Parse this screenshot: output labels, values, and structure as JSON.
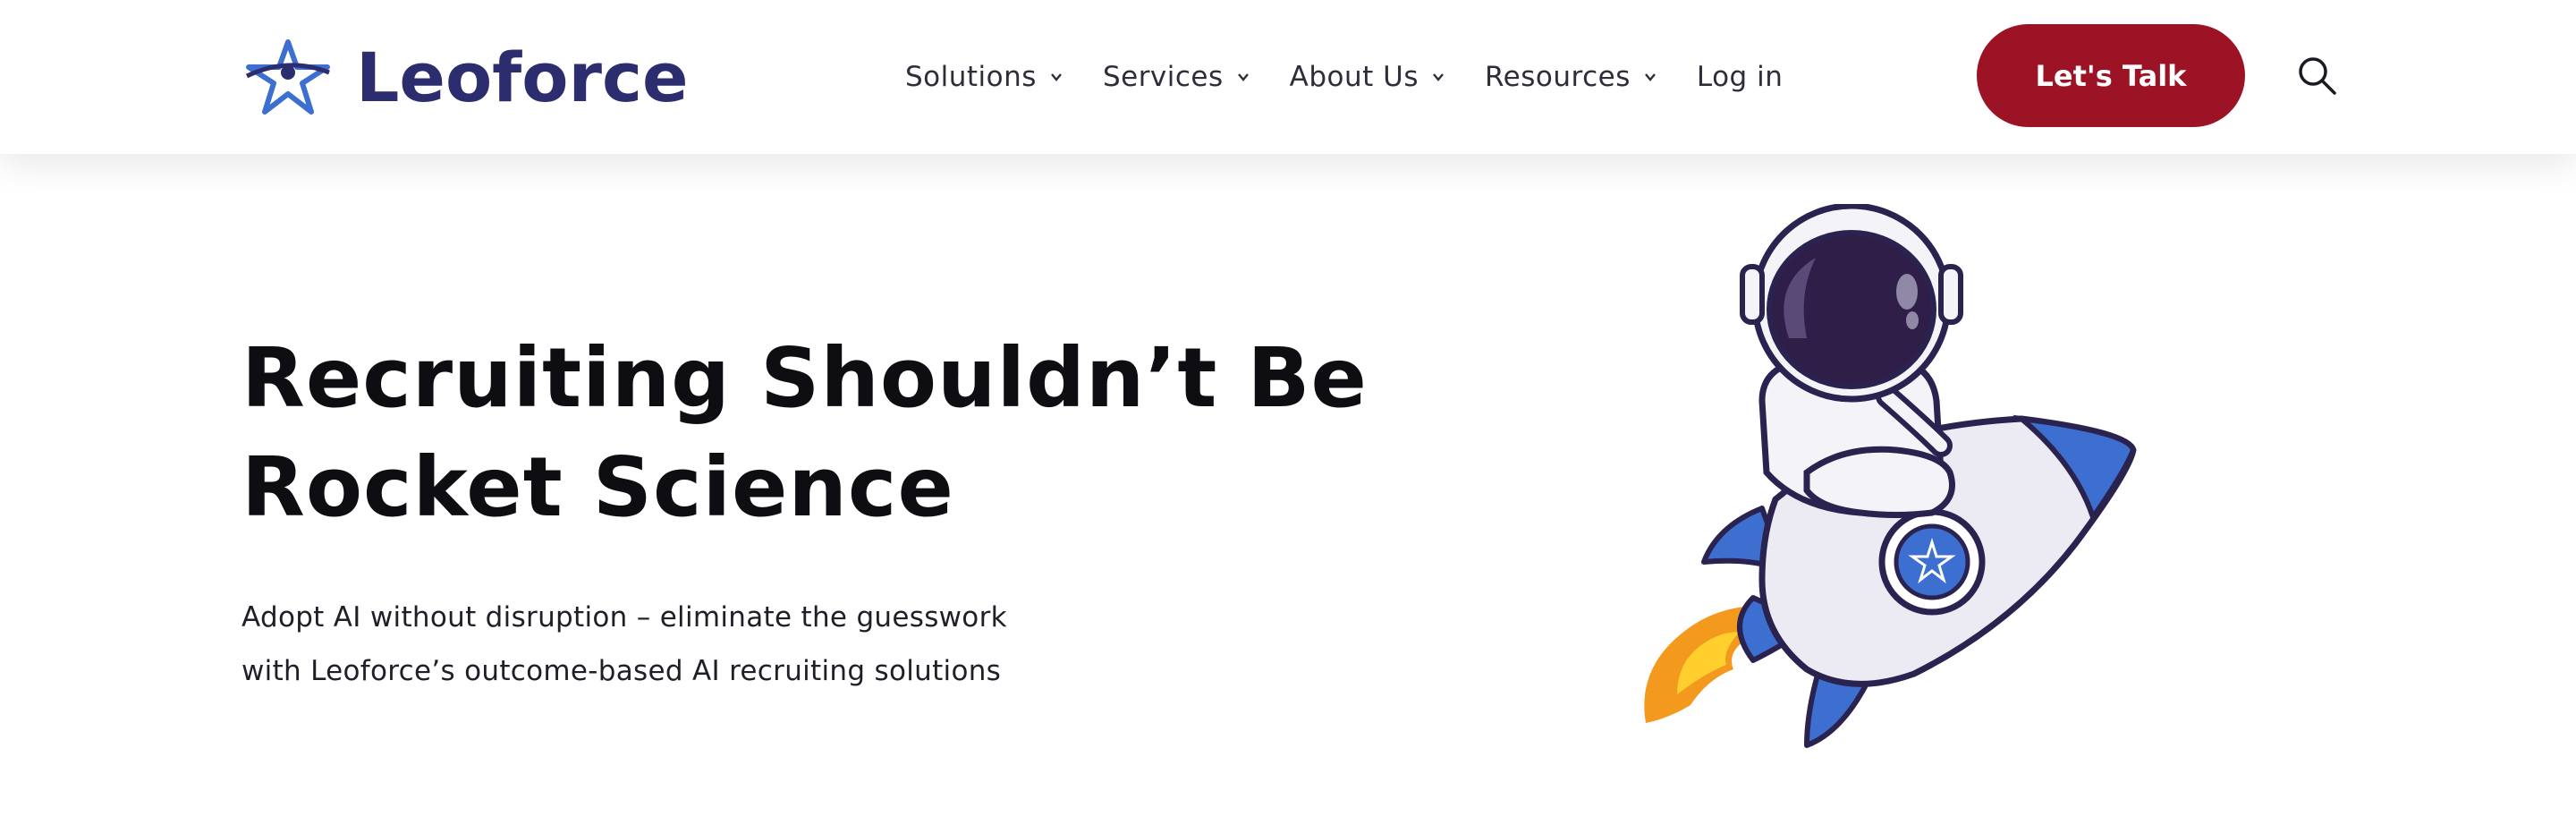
{
  "brand": {
    "name": "Leoforce",
    "logo_color": "#2b2d6e",
    "logo_accent": "#3d6fd0"
  },
  "nav": {
    "items": [
      {
        "label": "Solutions",
        "has_dropdown": true
      },
      {
        "label": "Services",
        "has_dropdown": true
      },
      {
        "label": "About Us",
        "has_dropdown": true
      },
      {
        "label": "Resources",
        "has_dropdown": true
      }
    ],
    "login_label": "Log in"
  },
  "cta": {
    "label": "Let's Talk",
    "color": "#9c1325"
  },
  "search": {
    "icon": "search-icon"
  },
  "hero": {
    "title_line1": "Recruiting Shouldn’t Be",
    "title_line2": "Rocket Science",
    "subtitle_line1": "Adopt AI without disruption – eliminate the guesswork",
    "subtitle_line2": "with Leoforce’s outcome-based AI recruiting solutions",
    "illustration": "astronaut-riding-rocket-illustration"
  }
}
